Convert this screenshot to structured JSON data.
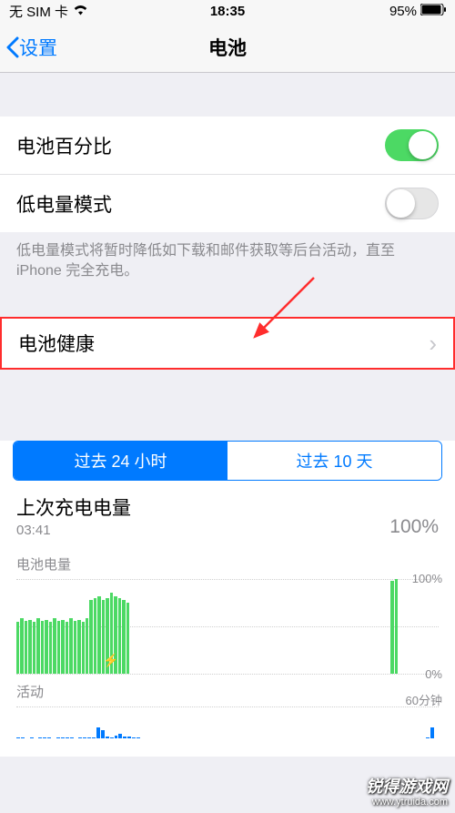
{
  "status": {
    "carrier": "无 SIM 卡",
    "time": "18:35",
    "battery_pct": "95%"
  },
  "nav": {
    "back": "设置",
    "title": "电池"
  },
  "cells": {
    "battery_percentage": "电池百分比",
    "low_power_mode": "低电量模式",
    "low_power_desc": "低电量模式将暂时降低如下载和邮件获取等后台活动，直至 iPhone 完全充电。",
    "battery_health": "电池健康"
  },
  "seg": {
    "h24": "过去 24 小时",
    "d10": "过去 10 天"
  },
  "last_charge": {
    "title": "上次充电电量",
    "time": "03:41",
    "pct": "100%"
  },
  "charts": {
    "level_label": "电池电量",
    "y100": "100%",
    "y0": "0%",
    "activity_label": "活动",
    "activity_y": "60分钟"
  },
  "watermark": {
    "brand": "锐得游戏网",
    "url": "www.ytruida.com"
  },
  "chart_data": {
    "type": "bar",
    "title": "电池电量",
    "ylabel": "%",
    "ylim": [
      0,
      100
    ],
    "series": [
      {
        "name": "电池电量",
        "values": [
          55,
          58,
          56,
          57,
          55,
          58,
          56,
          57,
          55,
          58,
          56,
          57,
          55,
          58,
          56,
          57,
          55,
          58,
          78,
          80,
          82,
          78,
          80,
          85,
          82,
          80,
          78,
          75,
          0,
          0,
          0,
          0,
          0,
          0,
          0,
          0,
          0,
          0,
          0,
          0,
          0,
          0,
          0,
          0,
          0,
          0,
          0,
          0,
          0,
          0,
          0,
          0,
          0,
          0,
          0,
          0,
          0,
          0,
          0,
          0,
          0,
          0,
          0,
          0,
          0,
          0,
          0,
          0,
          0,
          0,
          0,
          0,
          0,
          0,
          0,
          0,
          0,
          0,
          0,
          0,
          0,
          0,
          0,
          0,
          0,
          0,
          0,
          0,
          0,
          0,
          0,
          0,
          98,
          100,
          0
        ]
      },
      {
        "name": "活动",
        "values": [
          2,
          1,
          0,
          1,
          0,
          2,
          1,
          1,
          0,
          1,
          1,
          2,
          1,
          0,
          1,
          2,
          1,
          1,
          20,
          15,
          3,
          2,
          5,
          8,
          4,
          3,
          2,
          2,
          0,
          0,
          0,
          0,
          0,
          0,
          0,
          0,
          0,
          0,
          0,
          0,
          0,
          0,
          0,
          0,
          0,
          0,
          0,
          0,
          0,
          0,
          0,
          0,
          0,
          0,
          0,
          0,
          0,
          0,
          0,
          0,
          0,
          0,
          0,
          0,
          0,
          0,
          0,
          0,
          0,
          0,
          0,
          0,
          0,
          0,
          0,
          0,
          0,
          0,
          0,
          0,
          0,
          0,
          0,
          0,
          0,
          0,
          0,
          0,
          0,
          0,
          0,
          0,
          1,
          20,
          0
        ]
      }
    ]
  }
}
